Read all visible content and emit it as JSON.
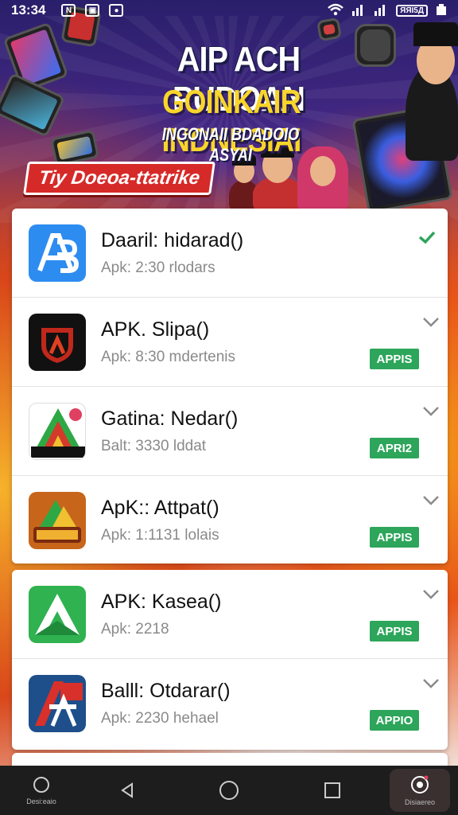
{
  "status_bar": {
    "time": "13:34",
    "left_icons": [
      "notification-n-icon",
      "gallery-icon",
      "app-icon"
    ],
    "battery_text": "ЯЯІ5Д"
  },
  "banner": {
    "title_line1": "AIP ACH PUDOAN",
    "title_line2": "GOINKAIR INDNESIAI",
    "subtitle": "INGONAII BDADOIO ASYAI",
    "cta_label": "Tiy Doeoa-ttatrike"
  },
  "apps": [
    {
      "name": "Daaril: hidarad()",
      "meta": "Apk: 2:30 rlodars",
      "status": "installed",
      "badge": "",
      "icon": "ab-app-icon",
      "icon_bg": "#2d8cf0"
    },
    {
      "name": "APK. Slipa()",
      "meta": "Apk: 8:30 mdertenis",
      "status": "download",
      "badge": "APPIS",
      "icon": "shield-app-icon",
      "icon_bg": "#111111"
    },
    {
      "name": "Gatina: Nedar()",
      "meta": "Balt: 3330 lddat",
      "status": "download",
      "badge": "APRI2",
      "icon": "triangle-app-icon",
      "icon_bg": "#ffffff"
    },
    {
      "name": "ApK:: Attpat()",
      "meta": "Apk: 1:1131 lolais",
      "status": "download",
      "badge": "APPIS",
      "icon": "game-app-icon",
      "icon_bg": "#c7651a"
    },
    {
      "name": "APK: Kasea()",
      "meta": "Apk: 2218",
      "status": "download",
      "badge": "APPIS",
      "icon": "green-a-app-icon",
      "icon_bg": "#2fb24f"
    },
    {
      "name": "Balll: Otdarar()",
      "meta": "Apk: 2230 hehael",
      "status": "download",
      "badge": "APPIO",
      "icon": "red-a-app-icon",
      "icon_bg": "#1e4f8a"
    }
  ],
  "nav": {
    "home_label": "Desi:eaio",
    "active_label": "Disiaereo"
  },
  "colors": {
    "badge_green": "#2da55a",
    "check_green": "#2da55a",
    "cta_red": "#d62a28",
    "title_yellow": "#f8d52a"
  }
}
